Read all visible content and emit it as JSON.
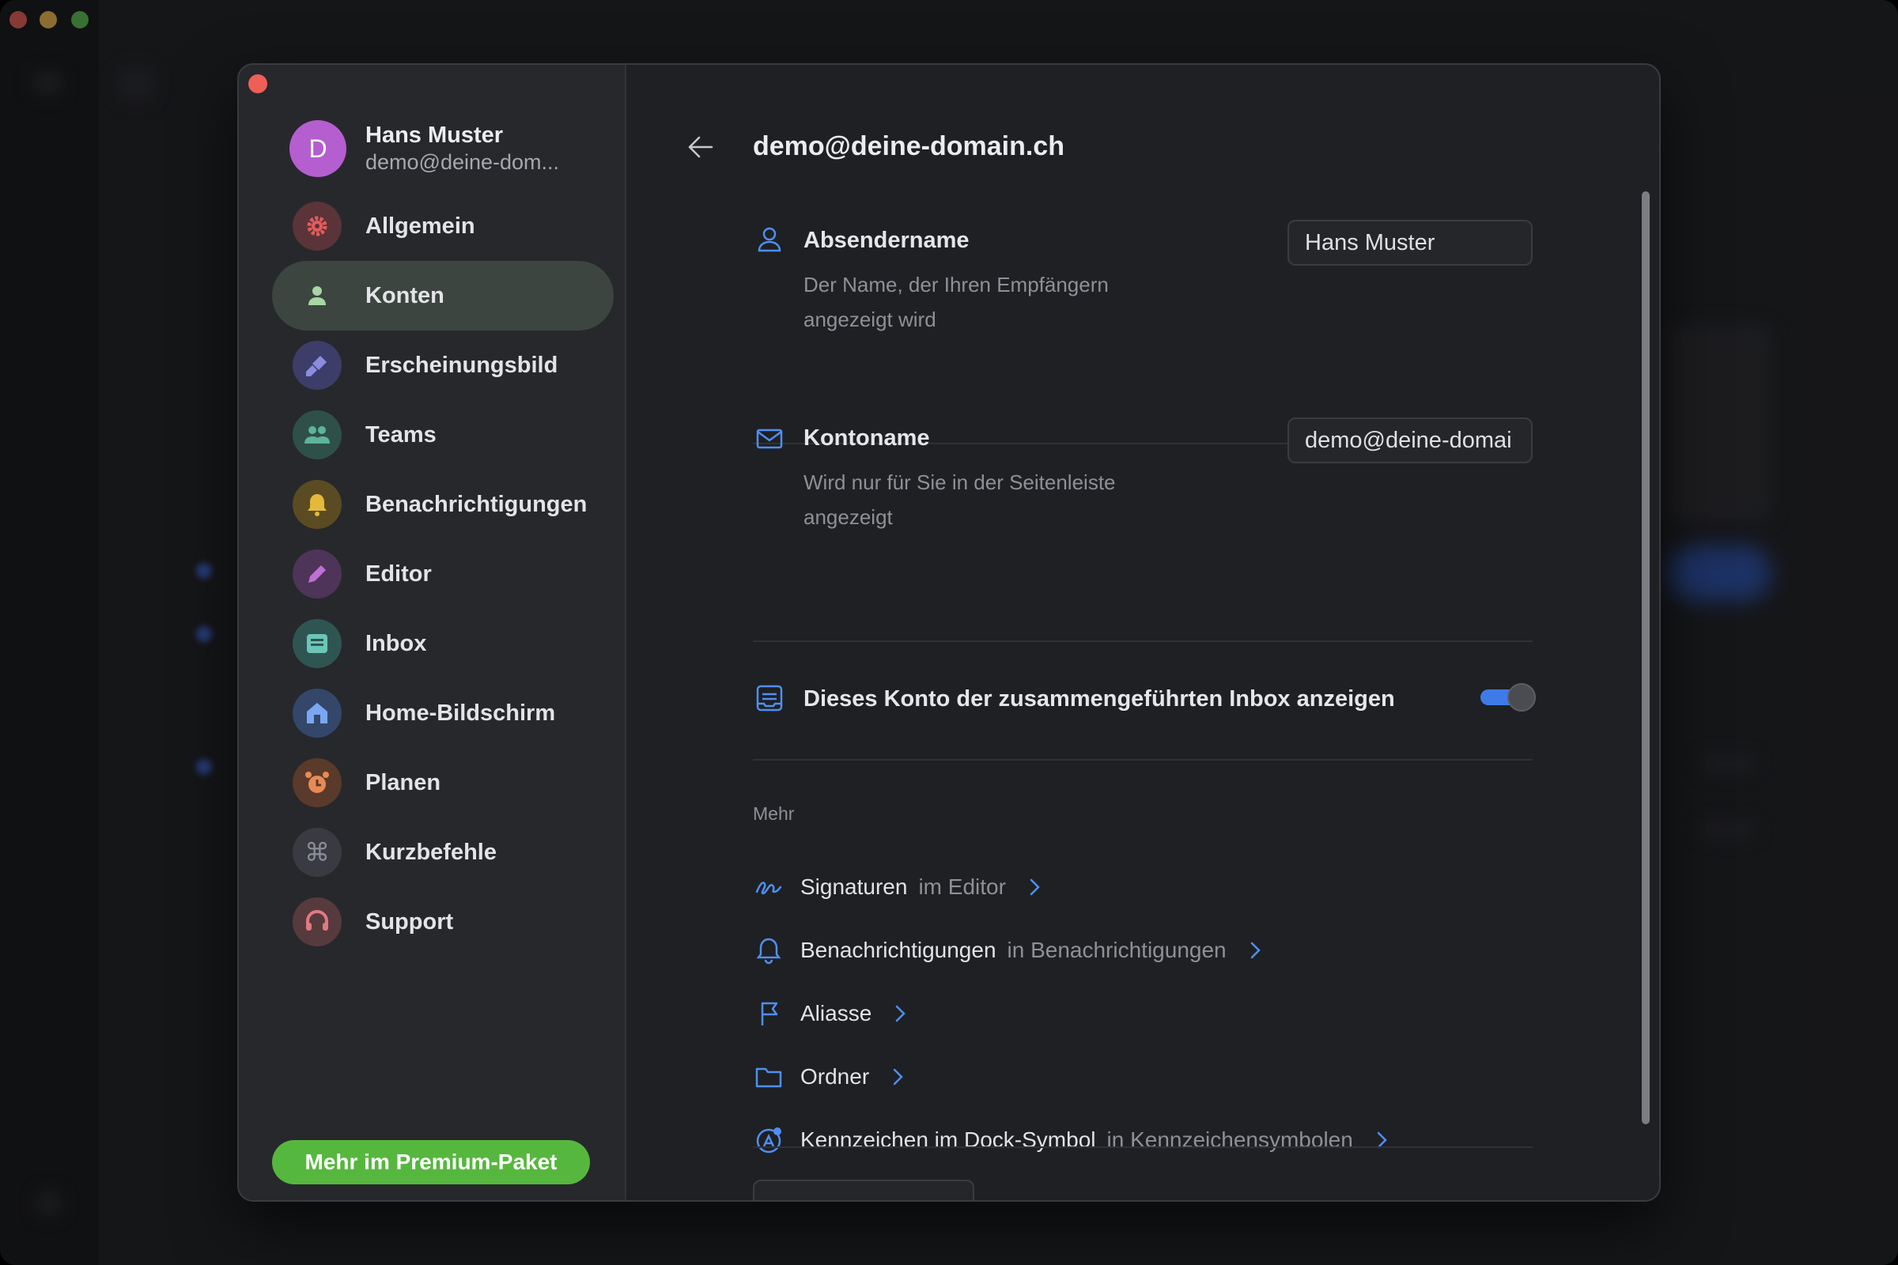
{
  "account": {
    "initial": "D",
    "name": "Hans Muster",
    "email": "demo@deine-dom..."
  },
  "sidebar": {
    "items": [
      {
        "label": "Allgemein",
        "icon": "gear-icon",
        "color": "#e45c5c"
      },
      {
        "label": "Konten",
        "icon": "person-icon",
        "color": "#8fbf8f",
        "active": true
      },
      {
        "label": "Erscheinungsbild",
        "icon": "brush-icon",
        "color": "#7f7fd6"
      },
      {
        "label": "Teams",
        "icon": "team-icon",
        "color": "#5cb49a"
      },
      {
        "label": "Benachrichtigungen",
        "icon": "bell-icon",
        "color": "#e3b93a"
      },
      {
        "label": "Editor",
        "icon": "pen-icon",
        "color": "#c06fd6"
      },
      {
        "label": "Inbox",
        "icon": "inbox-icon",
        "color": "#6cc5b8"
      },
      {
        "label": "Home-Bildschirm",
        "icon": "home-icon",
        "color": "#7aa7f0"
      },
      {
        "label": "Planen",
        "icon": "alarm-clock-icon",
        "color": "#e88a55"
      },
      {
        "label": "Kurzbefehle",
        "icon": "command-icon",
        "color": "#8a8d99"
      },
      {
        "label": "Support",
        "icon": "headset-icon",
        "color": "#e07a82"
      }
    ],
    "premium_label": "Mehr im Premium-Paket"
  },
  "main": {
    "title": "demo@deine-domain.ch",
    "sender": {
      "title": "Absendername",
      "desc": "Der Name, der Ihren Empfängern angezeigt wird",
      "value": "Hans Muster"
    },
    "account_name": {
      "title": "Kontoname",
      "desc": "Wird nur für Sie in der Seitenleiste angezeigt",
      "value": "demo@deine-domai"
    },
    "unified_inbox": {
      "title": "Dieses Konto der zusammengeführten Inbox anzeigen",
      "enabled": true
    },
    "more_label": "Mehr",
    "links": [
      {
        "label": "Signaturen",
        "sub": "im Editor",
        "icon": "signature-icon"
      },
      {
        "label": "Benachrichtigungen",
        "sub": "in Benachrichtigungen",
        "icon": "bell-icon"
      },
      {
        "label": "Aliasse",
        "sub": "",
        "icon": "alias-icon"
      },
      {
        "label": "Ordner",
        "sub": "",
        "icon": "folder-icon"
      },
      {
        "label": "Kennzeichen im Dock-Symbol",
        "sub": "in Kennzeichensymbolen",
        "icon": "badge-icon"
      }
    ]
  },
  "colors": {
    "accent": "#3f7be8",
    "premium": "#56b73e",
    "active_nav": "#3c4540"
  }
}
